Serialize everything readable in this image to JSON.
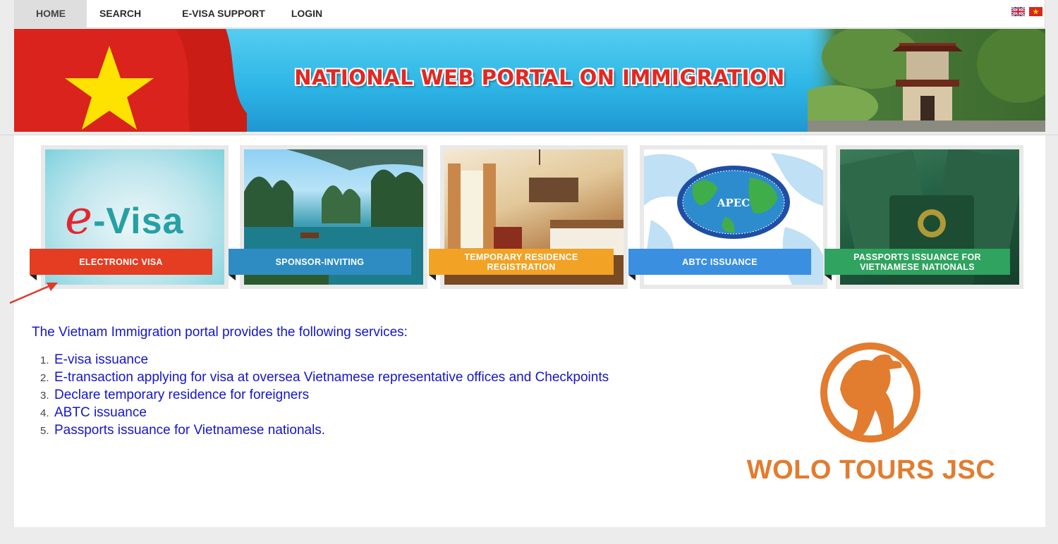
{
  "nav": {
    "home": "HOME",
    "search": "SEARCH",
    "support": "E-VISA SUPPORT",
    "login": "LOGIN"
  },
  "languages": [
    "english-flag",
    "vietnam-flag"
  ],
  "banner": {
    "title": "NATIONAL WEB PORTAL ON IMMIGRATION"
  },
  "tiles": [
    {
      "label": "ELECTRONIC VISA",
      "logo_prefix": "e",
      "logo_text": "-Visa",
      "color": "#e43d22"
    },
    {
      "label": "SPONSOR-INVITING",
      "color": "#2f8cc2"
    },
    {
      "label_line1": "TEMPORARY RESIDENCE",
      "label_line2": "REGISTRATION",
      "color": "#f2a225"
    },
    {
      "label": "ABTC ISSUANCE",
      "globe_text": "APEC",
      "color": "#3a8fe0"
    },
    {
      "label_line1": "PASSPORTS ISSUANCE FOR",
      "label_line2": "VIETNAMESE NATIONALS",
      "color": "#2fa35f"
    }
  ],
  "intro": "The Vietnam Immigration portal provides the following services:",
  "services": [
    {
      "num": "1.",
      "text": "E-visa issuance"
    },
    {
      "num": "2.",
      "text": "E-transaction applying for visa at oversea Vietnamese representative offices and Checkpoints"
    },
    {
      "num": "3.",
      "text": "Declare temporary residence for foreigners"
    },
    {
      "num": "4.",
      "text": "ABTC issuance"
    },
    {
      "num": "5.",
      "text": "Passports issuance for Vietnamese nationals."
    }
  ],
  "watermark": {
    "text": "WOLO TOURS JSC",
    "color": "#e27c2f"
  }
}
